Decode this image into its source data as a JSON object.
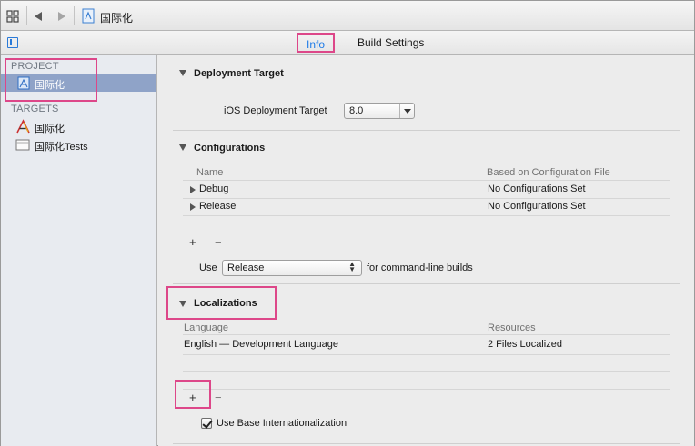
{
  "jumpbar": {
    "breadcrumb": "国际化"
  },
  "tabs": {
    "info": "Info",
    "build_settings": "Build Settings"
  },
  "sidebar": {
    "project_header": "PROJECT",
    "project_item": "国际化",
    "targets_header": "TARGETS",
    "targets": [
      "国际化",
      "国际化Tests"
    ]
  },
  "deployment": {
    "title": "Deployment Target",
    "label": "iOS Deployment Target",
    "value": "8.0"
  },
  "configurations": {
    "title": "Configurations",
    "columns": [
      "Name",
      "Based on Configuration File"
    ],
    "rows": [
      {
        "name": "Debug",
        "file": "No Configurations Set"
      },
      {
        "name": "Release",
        "file": "No Configurations Set"
      }
    ],
    "add": "+",
    "remove": "−",
    "use_label": "Use",
    "use_value": "Release",
    "use_suffix": "for command-line builds"
  },
  "localizations": {
    "title": "Localizations",
    "columns": [
      "Language",
      "Resources"
    ],
    "rows": [
      {
        "language": "English — Development Language",
        "resources": "2 Files Localized"
      }
    ],
    "add": "+",
    "remove": "−",
    "base_internationalization": "Use Base Internationalization"
  },
  "colors": {
    "accent_blue": "#1e7be8",
    "highlight_pink": "#dd4789",
    "selection": "#8fa3c8"
  }
}
